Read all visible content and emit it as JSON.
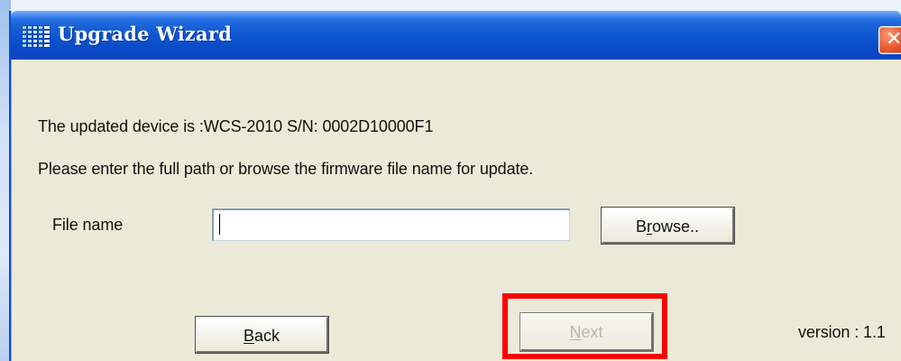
{
  "window": {
    "title": "Upgrade Wizard",
    "close_icon_glyph": "✕"
  },
  "content": {
    "device_line": "The updated device is :WCS-2010 S/N: 0002D10000F1",
    "instruction_line": "Please enter the full path or browse the firmware file name for update.",
    "file_name_label": "File name",
    "file_name_value": "",
    "version_label": "version : 1.1"
  },
  "buttons": {
    "browse_before": "B",
    "browse_mnemonic": "r",
    "browse_after": "owse..",
    "back_mnemonic": "B",
    "back_after": "ack",
    "next_mnemonic": "N",
    "next_after": "ext"
  },
  "colors": {
    "titlebar": "#0a4ac6",
    "window_background": "#ece9d8",
    "highlight": "#ff0000",
    "disabled_text": "#b7b4a8"
  },
  "icons": {
    "app_icon": "upgrade-wizard-app-icon",
    "close_icon": "close-icon"
  }
}
